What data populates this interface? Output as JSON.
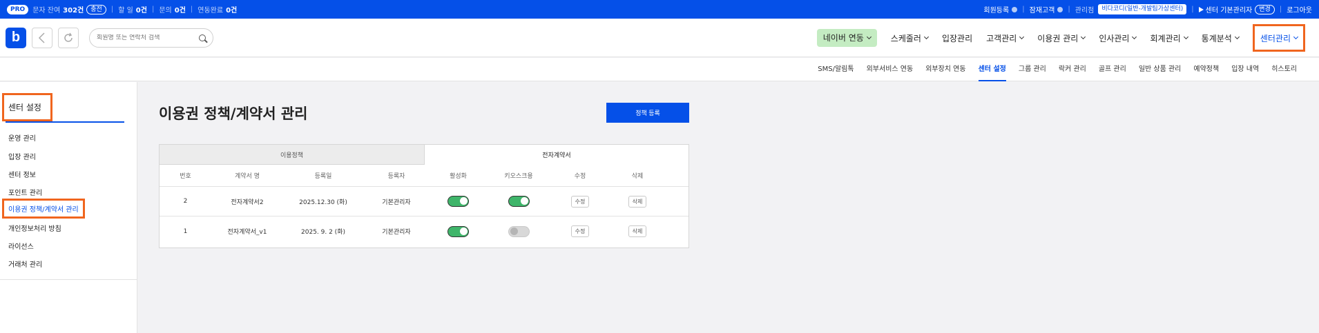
{
  "topbar": {
    "pro": "PRO",
    "sms_label": "문자 잔여",
    "sms_value": "302건",
    "charge": "충전",
    "todo_label": "할 일",
    "todo_value": "0건",
    "inquiry_label": "문의",
    "inquiry_value": "0건",
    "link_label": "연동완료",
    "link_value": "0건",
    "member_register": "회원등록",
    "prospect": "잠재고객",
    "manager_label": "관리점",
    "center_name": "비다코디(일반-개발팀가상센터)",
    "center_user": "센터 기본관리자",
    "change": "변경",
    "logout": "로그아웃"
  },
  "header": {
    "logo": "b",
    "search_placeholder": "회원명 또는 연락처 검색",
    "nav": [
      {
        "label": "네이버 연동"
      },
      {
        "label": "스케줄러"
      },
      {
        "label": "입장관리"
      },
      {
        "label": "고객관리"
      },
      {
        "label": "이용권 관리"
      },
      {
        "label": "인사관리"
      },
      {
        "label": "회계관리"
      },
      {
        "label": "통계분석"
      },
      {
        "label": "센터관리"
      }
    ]
  },
  "subnav": {
    "items": [
      "SMS/알림톡",
      "외부서비스 연동",
      "외부장치 연동",
      "센터 설정",
      "그룹 관리",
      "락커 관리",
      "골프 관리",
      "일반 상품 관리",
      "예약정책",
      "입장 내역",
      "히스토리"
    ],
    "active": "센터 설정"
  },
  "sidebar": {
    "title": "센터 설정",
    "items": [
      "운영 관리",
      "입장 관리",
      "센터 정보",
      "포인트 관리",
      "이용권 정책/계약서 관리",
      "개인정보처리 방침",
      "라이선스",
      "거래처 관리"
    ],
    "active": "이용권 정책/계약서 관리"
  },
  "content": {
    "title": "이용권 정책/계약서 관리",
    "register_button": "정책 등록",
    "tabs": [
      "이용정책",
      "전자계약서"
    ],
    "active_tab": "전자계약서",
    "columns": [
      "번호",
      "계약서 명",
      "등록일",
      "등록자",
      "활성화",
      "키오스크용",
      "수정",
      "삭제"
    ],
    "rows": [
      {
        "no": "2",
        "name": "전자계약서2",
        "date": "2025.12.30 (화)",
        "author": "기본관리자",
        "active": true,
        "kiosk": true,
        "edit": "수정",
        "delete": "삭제"
      },
      {
        "no": "1",
        "name": "전자계약서_v1",
        "date": "2025. 9. 2 (화)",
        "author": "기본관리자",
        "active": true,
        "kiosk": false,
        "edit": "수정",
        "delete": "삭제"
      }
    ]
  },
  "colors": {
    "primary": "#0550e8",
    "highlight": "#f0651e",
    "toggle_on": "#3fb56a",
    "naver": "#c4ecc2"
  }
}
